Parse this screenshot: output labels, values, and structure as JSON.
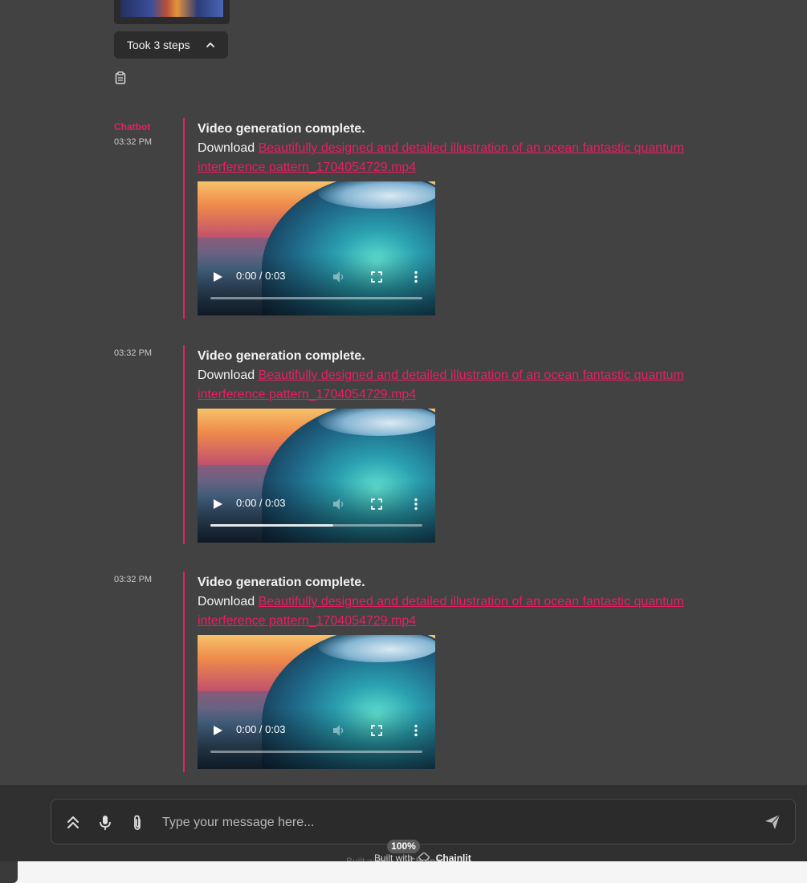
{
  "previous": {
    "steps_label": "Took 3 steps",
    "copy_icon": "clipboard-icon",
    "chevron_icon": "chevron-up-icon"
  },
  "messages": [
    {
      "author": "Chatbot",
      "time": "03:32 PM",
      "title": "Video generation complete.",
      "download_prefix": "Download ",
      "link": "Beautifully designed and detailed illustration of an ocean fantastic quantum interference pattern_1704054729.mp4",
      "video": {
        "time": "0:00 / 0:03",
        "buffered_fraction": 0.0
      }
    },
    {
      "author": "",
      "time": "03:32 PM",
      "title": "Video generation complete.",
      "download_prefix": "Download ",
      "link": "Beautifully designed and detailed illustration of an ocean fantastic quantum interference pattern_1704054729.mp4",
      "video": {
        "time": "0:00 / 0:03",
        "buffered_fraction": 0.58
      }
    },
    {
      "author": "",
      "time": "03:32 PM",
      "title": "Video generation complete.",
      "download_prefix": "Download ",
      "link": "Beautifully designed and detailed illustration of an ocean fantastic quantum interference pattern_1704054729.mp4",
      "video": {
        "time": "0:00 / 0:03",
        "buffered_fraction": 0.0
      }
    }
  ],
  "composer": {
    "placeholder": "Type your message here...",
    "icons": [
      "double-chevron-up-icon",
      "microphone-icon",
      "paperclip-icon",
      "send-icon"
    ]
  },
  "footer": {
    "zoom": "100%",
    "built_with": "Built with",
    "brand": "Chainlit"
  },
  "colors": {
    "accent": "#e91e63",
    "background": "#424242",
    "composer_bg": "#2b2b2b"
  }
}
